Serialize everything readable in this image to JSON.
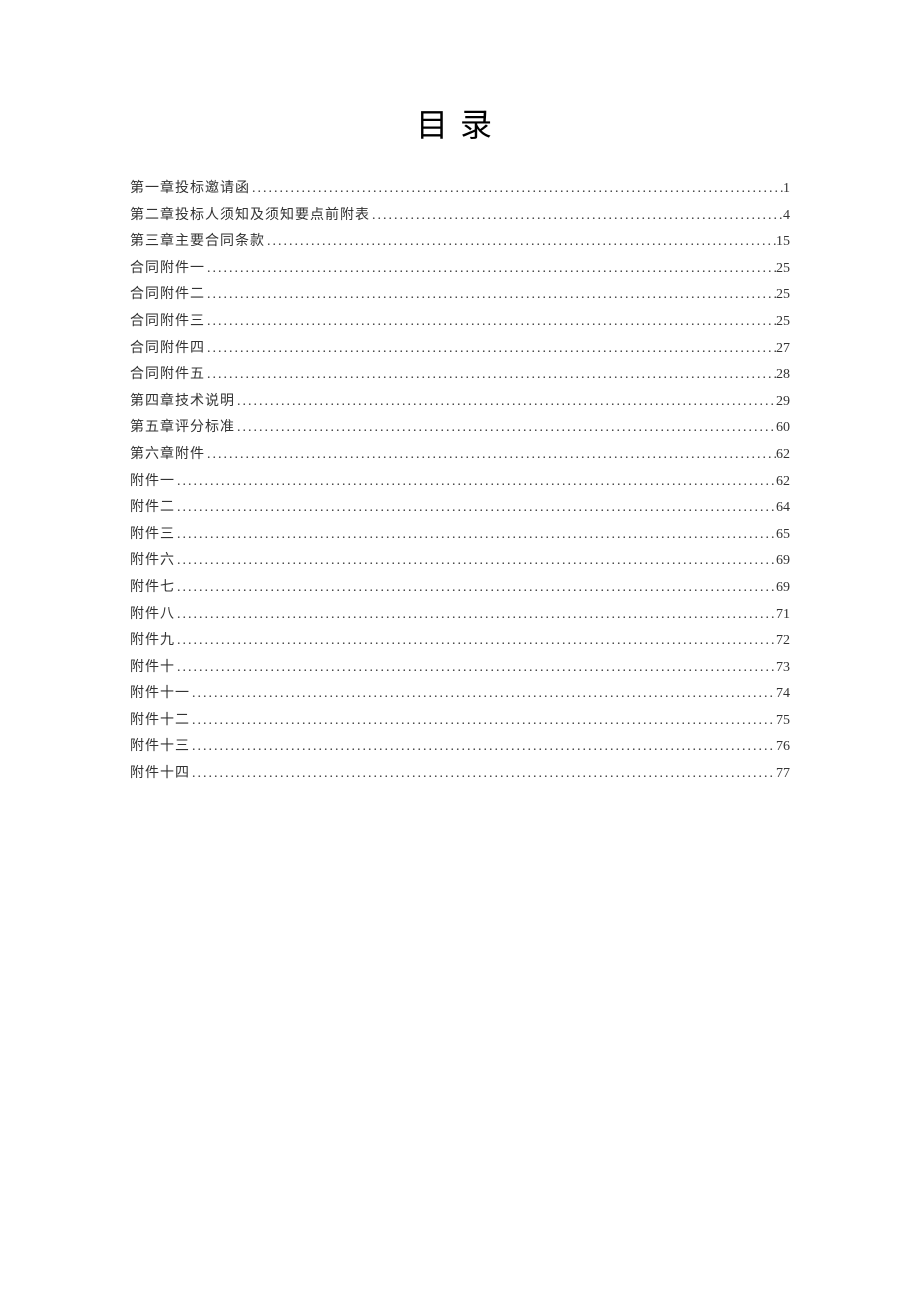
{
  "title": "目录",
  "toc": [
    {
      "label": "第一章投标邀请函",
      "page": "1"
    },
    {
      "label": "第二章投标人须知及须知要点前附表",
      "page": "4"
    },
    {
      "label": "第三章主要合同条款",
      "page": "15"
    },
    {
      "label": "合同附件一",
      "page": "25"
    },
    {
      "label": "合同附件二",
      "page": "25"
    },
    {
      "label": "合同附件三",
      "page": "25"
    },
    {
      "label": "合同附件四",
      "page": "27"
    },
    {
      "label": "合同附件五",
      "page": "28"
    },
    {
      "label": "第四章技术说明",
      "page": "29"
    },
    {
      "label": "第五章评分标准",
      "page": "60"
    },
    {
      "label": "第六章附件",
      "page": "62"
    },
    {
      "label": "附件一",
      "page": "62"
    },
    {
      "label": "附件二",
      "page": "64"
    },
    {
      "label": "附件三",
      "page": "65"
    },
    {
      "label": "附件六",
      "page": "69"
    },
    {
      "label": "附件七",
      "page": "69"
    },
    {
      "label": "附件八",
      "page": "71"
    },
    {
      "label": "附件九",
      "page": "72"
    },
    {
      "label": "附件十",
      "page": "73"
    },
    {
      "label": "附件十一",
      "page": "74"
    },
    {
      "label": "附件十二",
      "page": "75"
    },
    {
      "label": "附件十三",
      "page": "76"
    },
    {
      "label": "附件十四",
      "page": "77"
    }
  ]
}
